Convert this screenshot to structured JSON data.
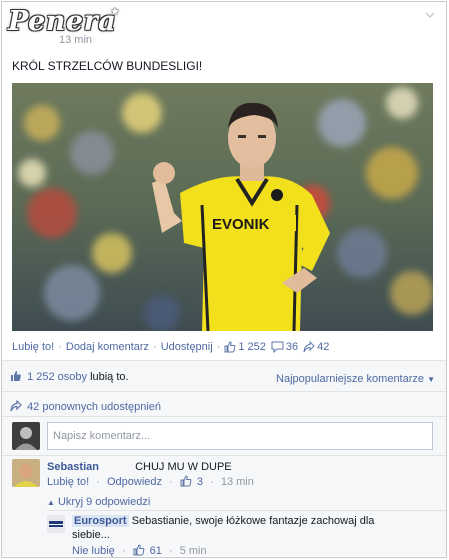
{
  "brand": {
    "logo_text": "Penera"
  },
  "post": {
    "timestamp": "13 min",
    "title": "KRÓL STRZELCÓW BUNDESLIGI!",
    "photo": {
      "jersey_text": "EVONIK"
    }
  },
  "actions": {
    "like": "Lubię to!",
    "comment": "Dodaj komentarz",
    "share": "Udostępnij",
    "like_count": "1 252",
    "comment_count": "36",
    "share_count": "42"
  },
  "summary": {
    "likes_count": "1 252 osoby",
    "likes_suffix": "lubią to.",
    "sort_label": "Najpopularniejsze komentarze",
    "shares_text": "42 ponownych udostępnień"
  },
  "comment_box": {
    "placeholder": "Napisz komentarz..."
  },
  "comments": [
    {
      "author": "Sebastian",
      "text": "CHUJ MU W DUPE",
      "like_label": "Lubię to!",
      "reply_label": "Odpowiedz",
      "like_count": "3",
      "time": "13 min",
      "hide_replies": "Ukryj 9 odpowiedzi"
    }
  ],
  "reply": {
    "author": "Eurosport",
    "text": "Sebastianie, swoje łóżkowe fantazje zachowaj dla",
    "text_cont": "siebie...",
    "unlike_label": "Nie lubię",
    "like_count": "61",
    "time": "5 min"
  },
  "colors": {
    "link": "#4e69a2",
    "accent": "#3b5998",
    "jersey": "#f2e01c"
  }
}
